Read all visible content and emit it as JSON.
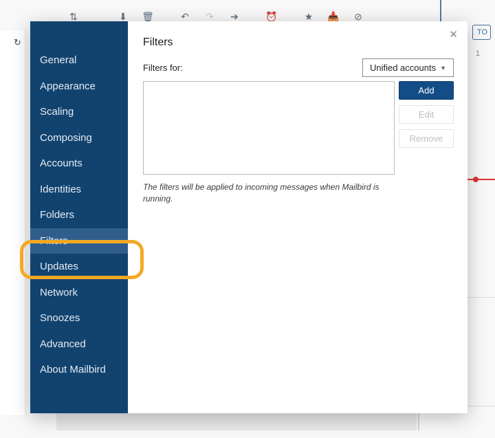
{
  "toolbar_icons": [
    "download",
    "delete",
    "reply",
    "reply-all",
    "forward",
    "snooze",
    "star",
    "archive",
    "block"
  ],
  "bg": {
    "today_button": "TO",
    "day_num": "1"
  },
  "sidebar": {
    "items": [
      {
        "name": "general",
        "label": "General"
      },
      {
        "name": "appearance",
        "label": "Appearance"
      },
      {
        "name": "scaling",
        "label": "Scaling"
      },
      {
        "name": "composing",
        "label": "Composing"
      },
      {
        "name": "accounts",
        "label": "Accounts"
      },
      {
        "name": "identities",
        "label": "Identities"
      },
      {
        "name": "folders",
        "label": "Folders"
      },
      {
        "name": "filters",
        "label": "Filters",
        "selected": true
      },
      {
        "name": "updates",
        "label": "Updates"
      },
      {
        "name": "network",
        "label": "Network"
      },
      {
        "name": "snoozes",
        "label": "Snoozes"
      },
      {
        "name": "advanced",
        "label": "Advanced"
      },
      {
        "name": "about",
        "label": "About Mailbird"
      }
    ]
  },
  "panel": {
    "title": "Filters",
    "filters_for_label": "Filters for:",
    "account_dropdown": {
      "selected": "Unified accounts"
    },
    "buttons": {
      "add": "Add",
      "edit": "Edit",
      "remove": "Remove"
    },
    "help_text": "The filters will be applied to incoming messages when Mailbird is running."
  }
}
